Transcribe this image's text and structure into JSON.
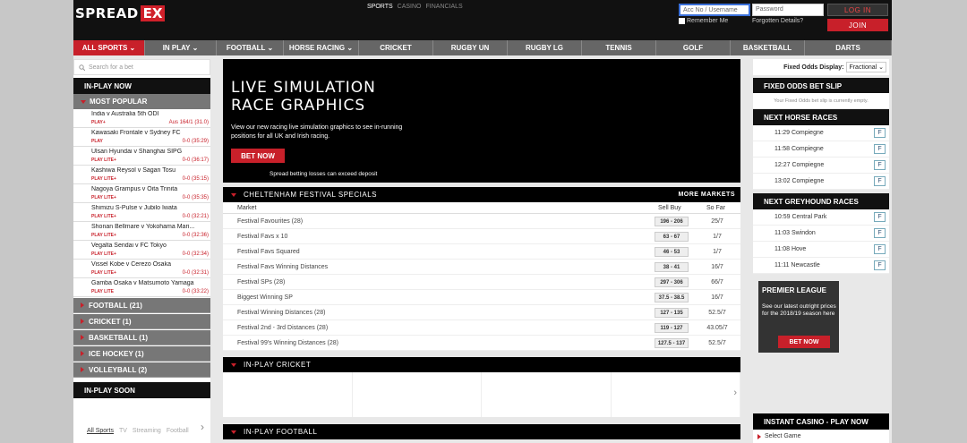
{
  "brand": {
    "part1": "SPREAD",
    "part2": "EX"
  },
  "top_links": [
    "SPORTS",
    "CASINO",
    "FINANCIALS"
  ],
  "login": {
    "account_placeholder": "Acc No / Username",
    "password_placeholder": "Password",
    "login_label": "LOG IN",
    "join_label": "JOIN",
    "remember_label": "Remember Me",
    "forgot_label": "Forgotten Details?"
  },
  "nav": [
    {
      "label": "ALL SPORTS ⌄"
    },
    {
      "label": "IN PLAY ⌄"
    },
    {
      "label": "FOOTBALL ⌄"
    },
    {
      "label": "HORSE RACING ⌄"
    },
    {
      "label": "CRICKET"
    },
    {
      "label": "RUGBY UN"
    },
    {
      "label": "RUGBY LG"
    },
    {
      "label": "TENNIS"
    },
    {
      "label": "GOLF"
    },
    {
      "label": "BASKETBALL"
    },
    {
      "label": "DARTS"
    }
  ],
  "left": {
    "search_placeholder": "Search for a bet",
    "inplay_title": "IN-PLAY NOW",
    "popular_title": "MOST POPULAR",
    "matches": [
      {
        "name": "India v Australia 5th ODI",
        "badge": "PLAY+",
        "score": "Aus 164/1 (31.0)"
      },
      {
        "name": "Kawasaki Frontale v Sydney FC",
        "badge": "PLAY",
        "score": "0-0 (35:29)"
      },
      {
        "name": "Ulsan Hyundai v Shanghai SIPG",
        "badge": "PLAY LITE+",
        "score": "0-0 (36:17)"
      },
      {
        "name": "Kashiwa Reysol v Sagan Tosu",
        "badge": "PLAY LITE+",
        "score": "0-0 (35:15)"
      },
      {
        "name": "Nagoya Grampus v Oita Trinita",
        "badge": "PLAY LITE+",
        "score": "0-0 (35:35)"
      },
      {
        "name": "Shimizu S-Pulse v Jubilo Iwata",
        "badge": "PLAY LITE+",
        "score": "0-0 (32:21)"
      },
      {
        "name": "Shonan Bellmare v Yokohama Mari...",
        "badge": "PLAY LITE+",
        "score": "0-0 (32:36)"
      },
      {
        "name": "Vegalta Sendai v FC Tokyo",
        "badge": "PLAY LITE+",
        "score": "0-0 (32:34)"
      },
      {
        "name": "Vissel Kobe v Cerezo Osaka",
        "badge": "PLAY LITE+",
        "score": "0-0 (32:31)"
      },
      {
        "name": "Gamba Osaka v Matsumoto Yamaga",
        "badge": "PLAY LITE",
        "score": "0-0 (33:22)"
      }
    ],
    "sports": [
      "FOOTBALL (21)",
      "CRICKET (1)",
      "BASKETBALL (1)",
      "ICE HOCKEY (1)",
      "VOLLEYBALL (2)"
    ],
    "soon_title": "IN-PLAY SOON",
    "soon_tabs": [
      "All Sports",
      "TV",
      "Streaming",
      "Football"
    ]
  },
  "banner": {
    "line1": "LIVE SIMULATION",
    "line2": "RACE GRAPHICS",
    "text": "View our new racing live simulation graphics to see in-running positions for all UK and Irish racing.",
    "button": "BET NOW",
    "warning": "Spread betting losses can exceed deposit"
  },
  "cheltenham": {
    "title": "CHELTENHAM FESTIVAL SPECIALS",
    "more": "MORE MARKETS",
    "col_market": "Market",
    "col_sellbuy": "Sell  Buy",
    "col_sofar": "So Far",
    "rows": [
      {
        "market": "Festival Favourites (28)",
        "price": "196 - 206",
        "sofar": "25/7"
      },
      {
        "market": "Festival Favs x 10",
        "price": "63 - 67",
        "sofar": "1/7"
      },
      {
        "market": "Festival Favs Squared",
        "price": "46 - 53",
        "sofar": "1/7"
      },
      {
        "market": "Festival Favs Winning Distances",
        "price": "38 - 41",
        "sofar": "16/7"
      },
      {
        "market": "Festival SPs (28)",
        "price": "297 - 306",
        "sofar": "66/7"
      },
      {
        "market": "Biggest Winning SP",
        "price": "37.5 - 38.5",
        "sofar": "16/7"
      },
      {
        "market": "Festival Winning Distances (28)",
        "price": "127 - 135",
        "sofar": "52.5/7"
      },
      {
        "market": "Festival 2nd - 3rd Distances (28)",
        "price": "119 - 127",
        "sofar": "43.05/7"
      },
      {
        "market": "Festival 99's Winning Distances (28)",
        "price": "127.5 - 137",
        "sofar": "52.5/7"
      }
    ]
  },
  "inplay_cricket": "IN-PLAY CRICKET",
  "inplay_football": "IN-PLAY FOOTBALL",
  "right": {
    "odds_label": "Fixed Odds Display:",
    "odds_value": "Fractional ⌄",
    "betslip_title": "FIXED ODDS BET SLIP",
    "betslip_empty": "Your Fixed Odds bet slip is currently empty.",
    "horse_title": "NEXT HORSE RACES",
    "horse": [
      {
        "race": "11:29 Compiegne"
      },
      {
        "race": "11:58 Compiegne"
      },
      {
        "race": "12:27 Compiegne"
      },
      {
        "race": "13:02 Compiegne"
      }
    ],
    "grey_title": "NEXT GREYHOUND RACES",
    "grey": [
      {
        "race": "10:59 Central Park"
      },
      {
        "race": "11:03 Swindon"
      },
      {
        "race": "11:08 Hove"
      },
      {
        "race": "11:11 Newcastle"
      }
    ],
    "form_label": "F",
    "promo": {
      "title": "PREMIER LEAGUE",
      "text": "See our latest outright prices for the 2018/19 season here",
      "button": "BET NOW"
    },
    "casino_title": "INSTANT CASINO - PLAY NOW",
    "select_game": "Select Game"
  },
  "colors": {
    "accent": "#c8202a",
    "dark": "#111111"
  }
}
